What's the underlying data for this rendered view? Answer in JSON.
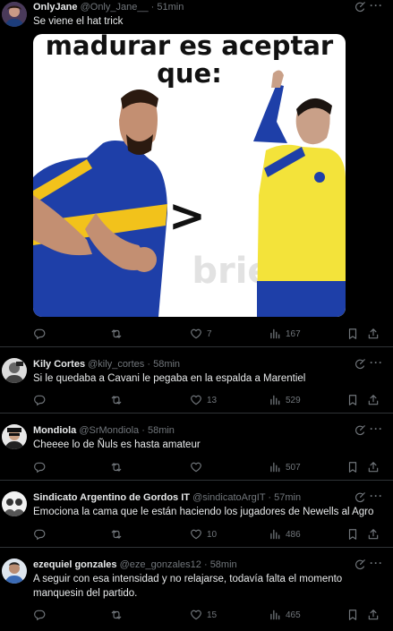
{
  "tweets": [
    {
      "name": "OnlyJane",
      "handle": "@Only_Jane__",
      "time": "51min",
      "text": "Se viene el hat trick",
      "media": {
        "caption_line1": "madurar es aceptar",
        "caption_line2": "que:",
        "symbol": ">",
        "watermark": "brielbi"
      },
      "reply": "",
      "retweet": "",
      "like": "7",
      "views": "167"
    },
    {
      "name": "Kily Cortes",
      "handle": "@kily_cortes",
      "time": "58min",
      "text": "Si le quedaba a Cavani le pegaba en la espalda a Marentiel",
      "reply": "",
      "retweet": "",
      "like": "13",
      "views": "529"
    },
    {
      "name": "Mondiola",
      "handle": "@SrMondiola",
      "time": "58min",
      "text": "Cheeee lo de Ñuls es hasta amateur",
      "reply": "",
      "retweet": "",
      "like": "",
      "views": "507"
    },
    {
      "name": "Sindicato Argentino de Gordos IT",
      "handle": "@sindicatoArgIT",
      "time": "57min",
      "text": "Emociona la cama que le están haciendo los jugadores de Newells al Agro",
      "reply": "",
      "retweet": "",
      "like": "10",
      "views": "486"
    },
    {
      "name": "ezequiel gonzales",
      "handle": "@eze_gonzales12",
      "time": "58min",
      "text": "A seguir con esa intensidad y no relajarse, todavía falta el momento manquesin del partido.",
      "reply": "",
      "retweet": "",
      "like": "15",
      "views": "465"
    }
  ],
  "separator": "·",
  "more_glyph": "···",
  "colors": {
    "background": "#000000",
    "text": "#e7e9ea",
    "muted": "#71767b",
    "border": "#2f3336"
  },
  "icons": [
    "reply-icon",
    "retweet-icon",
    "like-icon",
    "views-icon",
    "bookmark-icon",
    "share-icon",
    "grok-icon",
    "more-icon"
  ]
}
